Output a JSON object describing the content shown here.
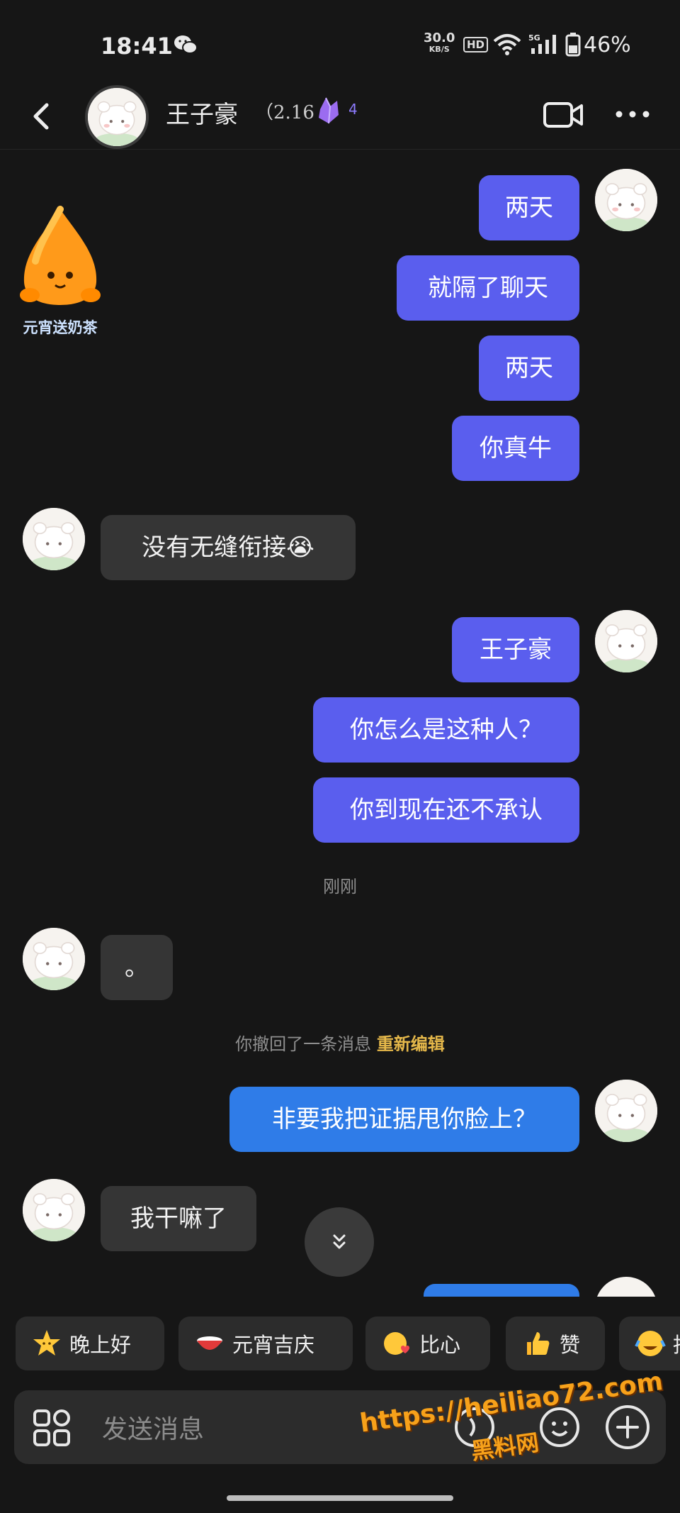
{
  "status_bar": {
    "time": "18:41",
    "net_speed": "30.0",
    "net_unit": "KB/S",
    "hd": "HD",
    "signal_label": "5G",
    "battery": "46%"
  },
  "header": {
    "contact_name": "王子豪",
    "score": "（2.16",
    "level": "4"
  },
  "sticker": {
    "label": "元宵送奶茶"
  },
  "messages": [
    {
      "text": "两天"
    },
    {
      "text": "就隔了聊天"
    },
    {
      "text": "两天"
    },
    {
      "text": "你真牛"
    },
    {
      "text": "没有无缝衔接😭"
    },
    {
      "text": "王子豪"
    },
    {
      "text": "你怎么是这种人？"
    },
    {
      "text": "你到现在还不承认"
    },
    {
      "text": "。"
    },
    {
      "text": "非要我把证据甩你脸上？"
    },
    {
      "text": "我干嘛了"
    }
  ],
  "meta": {
    "time_label": "刚刚",
    "recall_notice": "你撤回了一条消息",
    "re_edit": "重新编辑"
  },
  "quick_replies": [
    {
      "label": "晚上好",
      "icon": "star-icon"
    },
    {
      "label": "元宵吉庆",
      "icon": "bowl-icon"
    },
    {
      "label": "比心",
      "icon": "heart-hand-icon"
    },
    {
      "label": "赞",
      "icon": "thumbs-up-icon"
    },
    {
      "label": "抱",
      "icon": "laugh-cry-icon"
    }
  ],
  "input": {
    "placeholder": "发送消息"
  },
  "watermark": {
    "url": "https://heiliao72.com",
    "name": "黑料网"
  }
}
